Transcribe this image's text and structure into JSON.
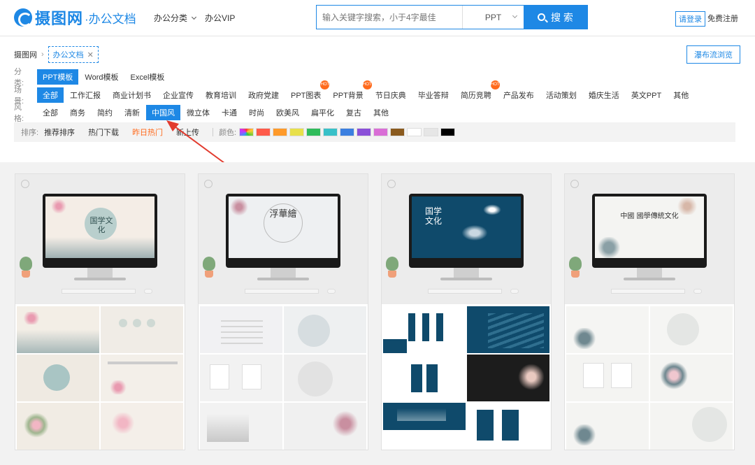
{
  "header": {
    "logo_text": "摄图网",
    "logo_sub": "·办公文档",
    "nav": [
      {
        "label": "办公分类"
      },
      {
        "label": "办公VIP"
      }
    ],
    "search": {
      "placeholder": "输入关键字搜索，小于4字最佳",
      "value": "",
      "type_selected": "PPT",
      "button_label": "搜 索"
    },
    "login_label": "请登录",
    "register_label": "免费注册"
  },
  "breadcrumb": {
    "root": "摄图网",
    "current": "办公文档"
  },
  "waterfall_label": "瀑布流浏览",
  "filters": {
    "category": {
      "label": "分类:",
      "items": [
        {
          "label": "PPT模板",
          "active": true
        },
        {
          "label": "Word模板"
        },
        {
          "label": "Excel模板"
        }
      ]
    },
    "scene": {
      "label": "场景:",
      "items": [
        {
          "label": "全部",
          "active": true
        },
        {
          "label": "工作汇报"
        },
        {
          "label": "商业计划书"
        },
        {
          "label": "企业宣传"
        },
        {
          "label": "教育培训"
        },
        {
          "label": "政府党建"
        },
        {
          "label": "PPT图表",
          "hot": true
        },
        {
          "label": "PPT背景",
          "hot": true
        },
        {
          "label": "节日庆典"
        },
        {
          "label": "毕业答辩"
        },
        {
          "label": "简历竞聘",
          "hot": true
        },
        {
          "label": "产品发布"
        },
        {
          "label": "活动策划"
        },
        {
          "label": "婚庆生活"
        },
        {
          "label": "英文PPT"
        },
        {
          "label": "其他"
        }
      ]
    },
    "style": {
      "label": "风格:",
      "items": [
        {
          "label": "全部"
        },
        {
          "label": "商务"
        },
        {
          "label": "简约"
        },
        {
          "label": "清新"
        },
        {
          "label": "中国风",
          "active": true
        },
        {
          "label": "微立体"
        },
        {
          "label": "卡通"
        },
        {
          "label": "时尚"
        },
        {
          "label": "欧美风"
        },
        {
          "label": "扁平化"
        },
        {
          "label": "复古"
        },
        {
          "label": "其他"
        }
      ]
    },
    "hot_badge": "HOT"
  },
  "sort": {
    "label": "排序:",
    "items": [
      {
        "label": "推荐排序"
      },
      {
        "label": "热门下载"
      },
      {
        "label": "昨日热门",
        "active": true
      },
      {
        "label": "新上传"
      }
    ],
    "color_label": "颜色:",
    "colors": [
      "#ff5a4a",
      "#ff9a2a",
      "#e8e04a",
      "#2fbb5a",
      "#38c0c8",
      "#3b7fe0",
      "#8a4fd8",
      "#d96ed6",
      "#8a5a1e",
      "#ffffff",
      "#e6e6e6",
      "#000000"
    ]
  },
  "cards": [
    {
      "title": "国学文化"
    },
    {
      "title": "浮華繪"
    },
    {
      "title": "国学文化"
    },
    {
      "title": "中國 國學傳統文化"
    }
  ]
}
